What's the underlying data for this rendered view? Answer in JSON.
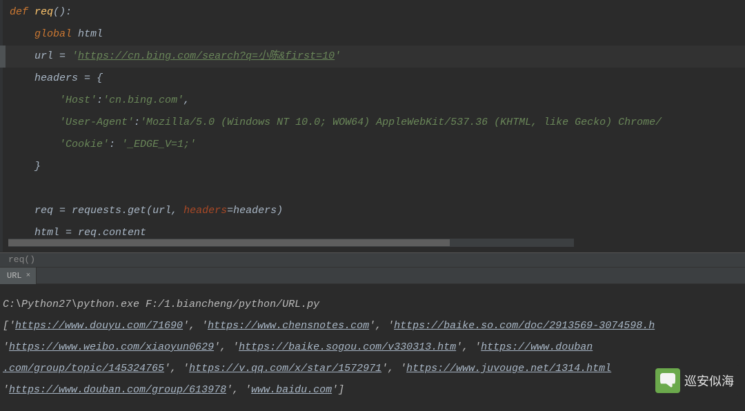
{
  "code": {
    "l1_def": "def",
    "l1_name": " req",
    "l1_paren": "():",
    "l2_global": "    global",
    "l2_var": " html",
    "l3_var": "    url ",
    "l3_eq": "= ",
    "l3_q1": "'",
    "l3_url": "https://cn.bing.com/search?q=小陈&first=10",
    "l3_q2": "'",
    "l4_var": "    headers ",
    "l4_eq": "= {",
    "l5_str1": "        'Host'",
    "l5_colon": ":",
    "l5_str2": "'cn.bing.com'",
    "l5_comma": ",",
    "l6_str1": "        'User-Agent'",
    "l6_colon": ":",
    "l6_str2": "'Mozilla/5.0 (Windows NT 10.0; WOW64) AppleWebKit/537.36 (KHTML, like Gecko) Chrome/",
    "l7_str1": "        'Cookie'",
    "l7_colon": ": ",
    "l7_str2": "'_EDGE_V=1;'",
    "l8_brace": "    }",
    "l9_blank": " ",
    "l10_var": "    req ",
    "l10_eq": "= ",
    "l10_mod": "requests.",
    "l10_fn": "get",
    "l10_open": "(url,",
    "l10_kwarg": " headers",
    "l10_kweq": "=",
    "l10_kwval": "headers)",
    "l11_var": "    html ",
    "l11_eq": "= ",
    "l11_rhs": "req.content"
  },
  "breadcrumb": "req()",
  "tab": {
    "label": "URL",
    "close": "×"
  },
  "console": {
    "cmd": "C:\\Python27\\python.exe F:/1.biancheng/python/URL.py",
    "b1": "['",
    "u1": "https://www.douyu.com/71690",
    "s1": "', '",
    "u2": "https://www.chensnotes.com",
    "s2": "', '",
    "u3": "https://baike.so.com/doc/2913569-3074598.h",
    "b2": " '",
    "u4": "https://www.weibo.com/xiaoyun0629",
    "s4": "', '",
    "u5": "https://baike.sogou.com/v330313.htm",
    "s5": "', '",
    "u6": "https://www.douban",
    "b3_pre": " ",
    "u7": ".com/group/topic/145324765",
    "s7": "', '",
    "u8": "https://v.qq.com/x/star/1572971",
    "s8": "', '",
    "u9": "https://www.juvouge.net/1314.html",
    "b4": " '",
    "u10": "https://www.douban.com/group/613978",
    "s10": "', '",
    "u11": "www.baidu.com",
    "s11": "']"
  },
  "watermark": "巡安似海"
}
